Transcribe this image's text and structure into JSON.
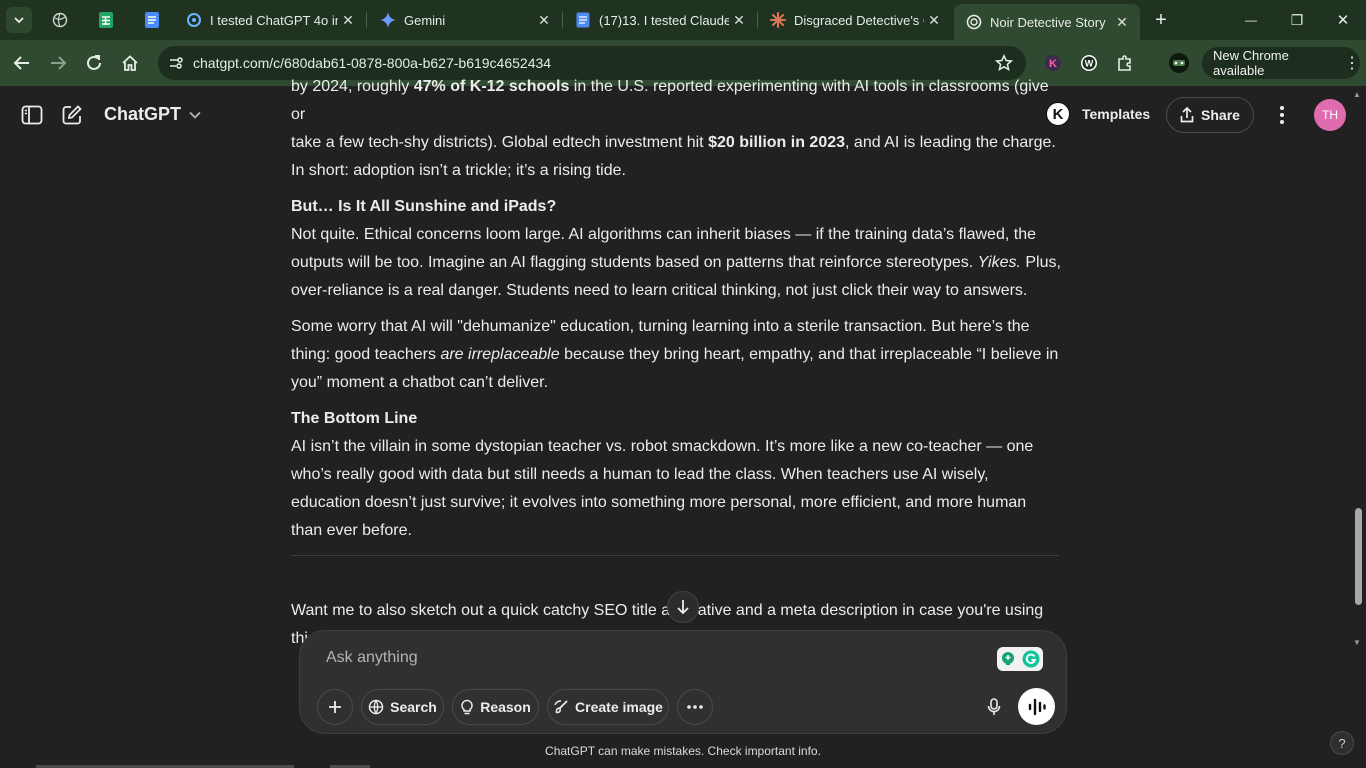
{
  "browser": {
    "tabs": [
      {
        "title": "I tested ChatGPT 4o im",
        "icon": "chatgpt-circle-icon",
        "active": false
      },
      {
        "title": "Gemini",
        "icon": "gemini-sparkle-icon",
        "active": false
      },
      {
        "title": "(17)13. I tested Claude",
        "icon": "docs-icon",
        "active": false
      },
      {
        "title": "Disgraced Detective's C",
        "icon": "claude-icon",
        "active": false
      },
      {
        "title": "Noir Detective Story",
        "icon": "openai-icon",
        "active": true
      }
    ],
    "close_glyph": "✕",
    "new_tab_glyph": "+",
    "url": "chatgpt.com/c/680dab61-0878-800a-b627-b619c4652434",
    "new_chrome_label": "New Chrome available",
    "new_chrome_menu": "⋮",
    "window_controls": {
      "minimize": "—",
      "maximize": "❐",
      "close": "✕"
    },
    "colors": {
      "frame": "#1f3320",
      "toolbar": "#2f4a31"
    }
  },
  "header": {
    "model_name": "ChatGPT",
    "model_chevron": "⌄",
    "k_badge": "K",
    "templates_label": "Templates",
    "share_label": "Share",
    "avatar_initials": "TH",
    "avatar_color": "#e06cb0"
  },
  "message": {
    "para1_line1_pre": "by 2024, roughly ",
    "para1_line1_bold": "47% of K-12 schools",
    "para1_line1_post": " in the U.S. reported experimenting with AI tools in classrooms (give or",
    "para1_line2_pre": "take a few tech-shy districts). Global edtech investment hit ",
    "para1_line2_bold": "$20 billion in 2023",
    "para1_line2_post": ", and AI is leading the charge.",
    "para1_line3": "In short: adoption isn’t a trickle; it’s a rising tide.",
    "heading2": "But… Is It All Sunshine and iPads?",
    "para2_pre": "Not quite. Ethical concerns loom large. AI algorithms can inherit biases — if the training data’s flawed, the outputs will be too. Imagine an AI flagging students based on patterns that reinforce stereotypes. ",
    "para2_italic": "Yikes.",
    "para2_post": " Plus, over-reliance is a real danger. Students need to learn critical thinking, not just click their way to answers.",
    "para3_pre": "Some worry that AI will \"dehumanize\" education, turning learning into a sterile transaction. But here’s the thing: good teachers ",
    "para3_italic": "are irreplaceable",
    "para3_post": " because they bring heart, empathy, and that irreplaceable “I believe in you” moment a chatbot can’t deliver.",
    "heading3": "The Bottom Line",
    "para4": "AI isn’t the villain in some dystopian teacher vs. robot smackdown. It’s more like a new co-teacher — one who’s really good with data but still needs a human to lead the class. When teachers use AI wisely, education doesn’t just survive; it evolves into something more personal, more efficient, and more human than ever before.",
    "followup_pre": "Want me to also sketch out a quick catchy SEO title al",
    "followup_post": "ative and a meta description in case you're using",
    "followup_line2": "thi"
  },
  "composer": {
    "placeholder": "Ask anything",
    "search_label": "Search",
    "reason_label": "Reason",
    "create_image_label": "Create image"
  },
  "footer": {
    "disclaimer": "ChatGPT can make mistakes. Check important info.",
    "help_glyph": "?"
  }
}
